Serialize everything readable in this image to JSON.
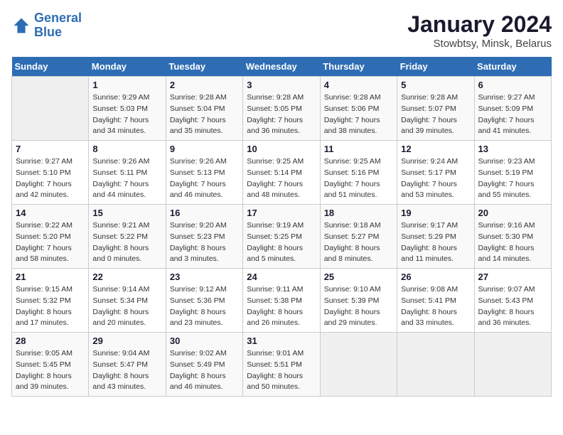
{
  "logo": {
    "line1": "General",
    "line2": "Blue"
  },
  "title": "January 2024",
  "subtitle": "Stowbtsy, Minsk, Belarus",
  "days_of_week": [
    "Sunday",
    "Monday",
    "Tuesday",
    "Wednesday",
    "Thursday",
    "Friday",
    "Saturday"
  ],
  "weeks": [
    [
      {
        "num": "",
        "sunrise": "",
        "sunset": "",
        "daylight": ""
      },
      {
        "num": "1",
        "sunrise": "Sunrise: 9:29 AM",
        "sunset": "Sunset: 5:03 PM",
        "daylight": "Daylight: 7 hours and 34 minutes."
      },
      {
        "num": "2",
        "sunrise": "Sunrise: 9:28 AM",
        "sunset": "Sunset: 5:04 PM",
        "daylight": "Daylight: 7 hours and 35 minutes."
      },
      {
        "num": "3",
        "sunrise": "Sunrise: 9:28 AM",
        "sunset": "Sunset: 5:05 PM",
        "daylight": "Daylight: 7 hours and 36 minutes."
      },
      {
        "num": "4",
        "sunrise": "Sunrise: 9:28 AM",
        "sunset": "Sunset: 5:06 PM",
        "daylight": "Daylight: 7 hours and 38 minutes."
      },
      {
        "num": "5",
        "sunrise": "Sunrise: 9:28 AM",
        "sunset": "Sunset: 5:07 PM",
        "daylight": "Daylight: 7 hours and 39 minutes."
      },
      {
        "num": "6",
        "sunrise": "Sunrise: 9:27 AM",
        "sunset": "Sunset: 5:09 PM",
        "daylight": "Daylight: 7 hours and 41 minutes."
      }
    ],
    [
      {
        "num": "7",
        "sunrise": "Sunrise: 9:27 AM",
        "sunset": "Sunset: 5:10 PM",
        "daylight": "Daylight: 7 hours and 42 minutes."
      },
      {
        "num": "8",
        "sunrise": "Sunrise: 9:26 AM",
        "sunset": "Sunset: 5:11 PM",
        "daylight": "Daylight: 7 hours and 44 minutes."
      },
      {
        "num": "9",
        "sunrise": "Sunrise: 9:26 AM",
        "sunset": "Sunset: 5:13 PM",
        "daylight": "Daylight: 7 hours and 46 minutes."
      },
      {
        "num": "10",
        "sunrise": "Sunrise: 9:25 AM",
        "sunset": "Sunset: 5:14 PM",
        "daylight": "Daylight: 7 hours and 48 minutes."
      },
      {
        "num": "11",
        "sunrise": "Sunrise: 9:25 AM",
        "sunset": "Sunset: 5:16 PM",
        "daylight": "Daylight: 7 hours and 51 minutes."
      },
      {
        "num": "12",
        "sunrise": "Sunrise: 9:24 AM",
        "sunset": "Sunset: 5:17 PM",
        "daylight": "Daylight: 7 hours and 53 minutes."
      },
      {
        "num": "13",
        "sunrise": "Sunrise: 9:23 AM",
        "sunset": "Sunset: 5:19 PM",
        "daylight": "Daylight: 7 hours and 55 minutes."
      }
    ],
    [
      {
        "num": "14",
        "sunrise": "Sunrise: 9:22 AM",
        "sunset": "Sunset: 5:20 PM",
        "daylight": "Daylight: 7 hours and 58 minutes."
      },
      {
        "num": "15",
        "sunrise": "Sunrise: 9:21 AM",
        "sunset": "Sunset: 5:22 PM",
        "daylight": "Daylight: 8 hours and 0 minutes."
      },
      {
        "num": "16",
        "sunrise": "Sunrise: 9:20 AM",
        "sunset": "Sunset: 5:23 PM",
        "daylight": "Daylight: 8 hours and 3 minutes."
      },
      {
        "num": "17",
        "sunrise": "Sunrise: 9:19 AM",
        "sunset": "Sunset: 5:25 PM",
        "daylight": "Daylight: 8 hours and 5 minutes."
      },
      {
        "num": "18",
        "sunrise": "Sunrise: 9:18 AM",
        "sunset": "Sunset: 5:27 PM",
        "daylight": "Daylight: 8 hours and 8 minutes."
      },
      {
        "num": "19",
        "sunrise": "Sunrise: 9:17 AM",
        "sunset": "Sunset: 5:29 PM",
        "daylight": "Daylight: 8 hours and 11 minutes."
      },
      {
        "num": "20",
        "sunrise": "Sunrise: 9:16 AM",
        "sunset": "Sunset: 5:30 PM",
        "daylight": "Daylight: 8 hours and 14 minutes."
      }
    ],
    [
      {
        "num": "21",
        "sunrise": "Sunrise: 9:15 AM",
        "sunset": "Sunset: 5:32 PM",
        "daylight": "Daylight: 8 hours and 17 minutes."
      },
      {
        "num": "22",
        "sunrise": "Sunrise: 9:14 AM",
        "sunset": "Sunset: 5:34 PM",
        "daylight": "Daylight: 8 hours and 20 minutes."
      },
      {
        "num": "23",
        "sunrise": "Sunrise: 9:12 AM",
        "sunset": "Sunset: 5:36 PM",
        "daylight": "Daylight: 8 hours and 23 minutes."
      },
      {
        "num": "24",
        "sunrise": "Sunrise: 9:11 AM",
        "sunset": "Sunset: 5:38 PM",
        "daylight": "Daylight: 8 hours and 26 minutes."
      },
      {
        "num": "25",
        "sunrise": "Sunrise: 9:10 AM",
        "sunset": "Sunset: 5:39 PM",
        "daylight": "Daylight: 8 hours and 29 minutes."
      },
      {
        "num": "26",
        "sunrise": "Sunrise: 9:08 AM",
        "sunset": "Sunset: 5:41 PM",
        "daylight": "Daylight: 8 hours and 33 minutes."
      },
      {
        "num": "27",
        "sunrise": "Sunrise: 9:07 AM",
        "sunset": "Sunset: 5:43 PM",
        "daylight": "Daylight: 8 hours and 36 minutes."
      }
    ],
    [
      {
        "num": "28",
        "sunrise": "Sunrise: 9:05 AM",
        "sunset": "Sunset: 5:45 PM",
        "daylight": "Daylight: 8 hours and 39 minutes."
      },
      {
        "num": "29",
        "sunrise": "Sunrise: 9:04 AM",
        "sunset": "Sunset: 5:47 PM",
        "daylight": "Daylight: 8 hours and 43 minutes."
      },
      {
        "num": "30",
        "sunrise": "Sunrise: 9:02 AM",
        "sunset": "Sunset: 5:49 PM",
        "daylight": "Daylight: 8 hours and 46 minutes."
      },
      {
        "num": "31",
        "sunrise": "Sunrise: 9:01 AM",
        "sunset": "Sunset: 5:51 PM",
        "daylight": "Daylight: 8 hours and 50 minutes."
      },
      {
        "num": "",
        "sunrise": "",
        "sunset": "",
        "daylight": ""
      },
      {
        "num": "",
        "sunrise": "",
        "sunset": "",
        "daylight": ""
      },
      {
        "num": "",
        "sunrise": "",
        "sunset": "",
        "daylight": ""
      }
    ]
  ]
}
